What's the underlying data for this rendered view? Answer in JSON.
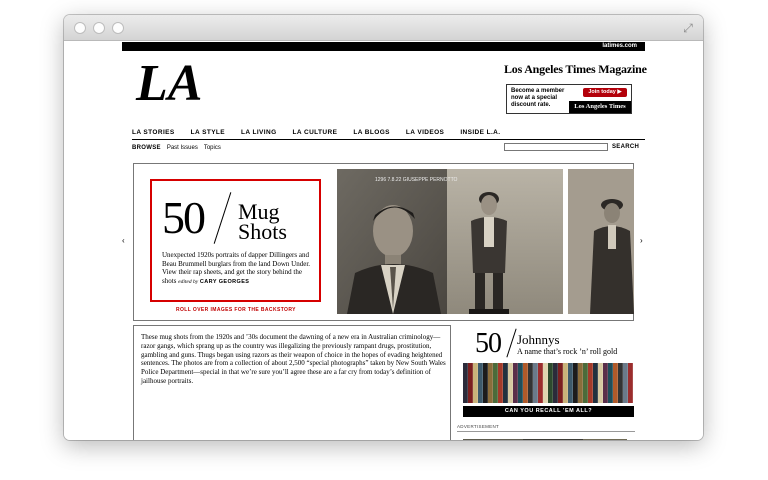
{
  "site": {
    "topbar_link": "latimes.com",
    "logo_text": "LA",
    "masthead": "Los Angeles Times Magazine"
  },
  "membership": {
    "text": "Become a member now at a special discount rate.",
    "join_button": "Join today ▶",
    "brand": "Los Angeles Times"
  },
  "nav": {
    "items": [
      "LA STORIES",
      "LA STYLE",
      "LA LIVING",
      "LA CULTURE",
      "LA BLOGS",
      "LA VIDEOS",
      "INSIDE L.A."
    ]
  },
  "subnav": {
    "browse": "BROWSE",
    "past_issues": "Past Issues",
    "topics": "Topics",
    "search_value": "",
    "search_label": "SEARCH"
  },
  "feature": {
    "number": "50",
    "title_line1": "Mug",
    "title_line2": "Shots",
    "description": "Unexpected 1920s portraits of dapper Dillingers and Beau Brummell burglars from the land Down Under. View their rap sheets, and get the story behind the shots",
    "edited_by": "edited by",
    "editor": "CARY GEORGES",
    "rollover": "ROLL OVER IMAGES FOR THE BACKSTORY",
    "photo_caption": "1296 7.8.22 GIUSEPPE PERNOTTO",
    "prev_arrow": "‹",
    "next_arrow": "›"
  },
  "article": {
    "body": "These mug shots from the 1920s and ’30s document the dawning of a new era in Australian criminology—razor gangs, which sprang up as the country was illegalizing the previously rampant drugs, prostitution, gambling and guns. Thugs began using razors as their weapon of choice in the hopes of evading heightened sentences. The photos are from a collection of about 2,500 “special photographs” taken by New South Wales Police Department—special in that we’re sure you’ll agree these are a far cry from today’s definition of jailhouse portraits."
  },
  "sidebar": {
    "number": "50",
    "title": "Johnnys",
    "subtitle": "A name that’s rock ’n’ roll gold",
    "button": "CAN YOU RECALL ’EM ALL?",
    "ad_label": "ADVERTISEMENT"
  },
  "colors": {
    "accent_red": "#d60000",
    "join_red": "#b3000a",
    "photo_sepia": "#8b8376"
  }
}
